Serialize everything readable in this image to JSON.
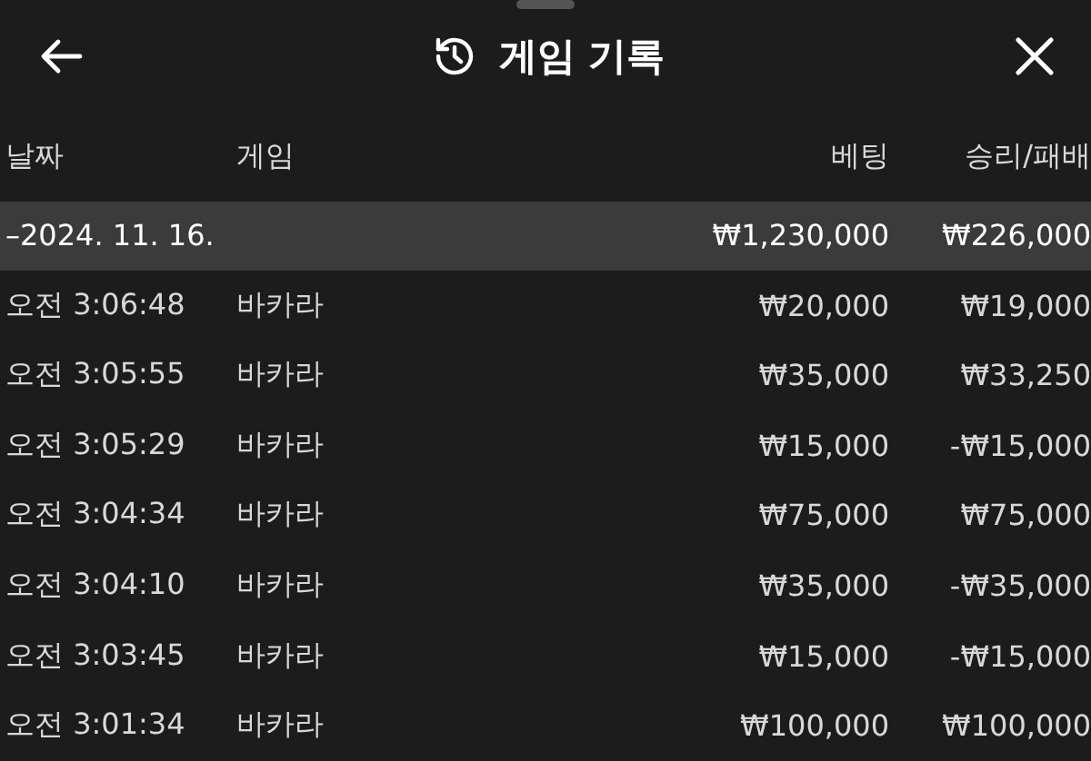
{
  "header": {
    "title": "게임 기록"
  },
  "table": {
    "columns": [
      "날짜",
      "게임",
      "베팅",
      "승리/패배"
    ],
    "group": {
      "date": "–2024. 11. 16.",
      "bet": "₩1,230,000",
      "result": "₩226,000"
    },
    "rows": [
      {
        "time": "오전 3:06:48",
        "game": "바카라",
        "bet": "₩20,000",
        "result": "₩19,000"
      },
      {
        "time": "오전 3:05:55",
        "game": "바카라",
        "bet": "₩35,000",
        "result": "₩33,250"
      },
      {
        "time": "오전 3:05:29",
        "game": "바카라",
        "bet": "₩15,000",
        "result": "-₩15,000"
      },
      {
        "time": "오전 3:04:34",
        "game": "바카라",
        "bet": "₩75,000",
        "result": "₩75,000"
      },
      {
        "time": "오전 3:04:10",
        "game": "바카라",
        "bet": "₩35,000",
        "result": "-₩35,000"
      },
      {
        "time": "오전 3:03:45",
        "game": "바카라",
        "bet": "₩15,000",
        "result": "-₩15,000"
      },
      {
        "time": "오전 3:01:34",
        "game": "바카라",
        "bet": "₩100,000",
        "result": "₩100,000"
      }
    ]
  }
}
